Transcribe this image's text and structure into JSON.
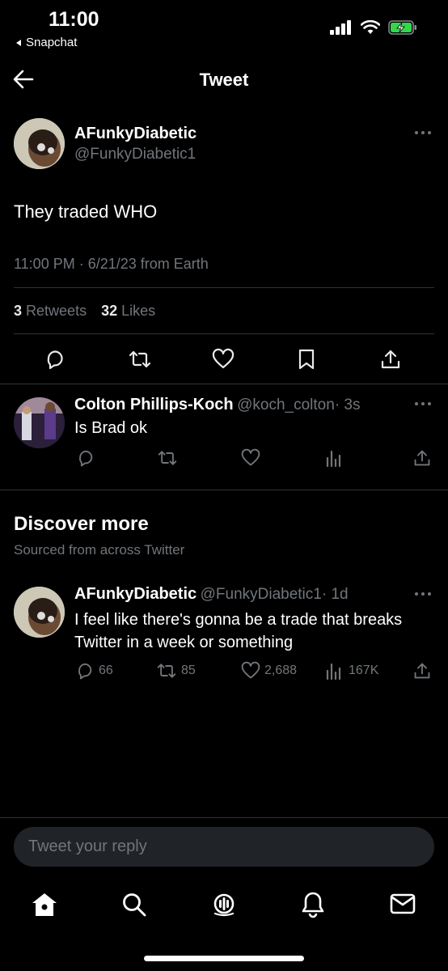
{
  "status_bar": {
    "time": "11:00",
    "back_app": "Snapchat"
  },
  "header": {
    "title": "Tweet"
  },
  "main_tweet": {
    "display_name": "AFunkyDiabetic",
    "handle": "@FunkyDiabetic1",
    "text": "They traded WHO",
    "timestamp": "11:00 PM · 6/21/23 from Earth",
    "retweets_count": "3",
    "retweets_label": "Retweets",
    "likes_count": "32",
    "likes_label": "Likes"
  },
  "reply": {
    "display_name": "Colton Phillips-Koch",
    "handle": "@koch_colton",
    "time": "· 3s",
    "text": "Is Brad ok"
  },
  "discover": {
    "title": "Discover more",
    "subtitle": "Sourced from across Twitter"
  },
  "discover_tweet": {
    "display_name": "AFunkyDiabetic",
    "handle": "@FunkyDiabetic1",
    "time": "· 1d",
    "text_line1": "I feel like there's gonna be a trade that breaks",
    "text_line2": "Twitter in a week or something",
    "replies": "66",
    "retweets": "85",
    "likes": "2,688",
    "views": "167K"
  },
  "reply_box": {
    "placeholder": "Tweet your reply"
  },
  "colors": {
    "background": "#000000",
    "text": "#e7e9ea",
    "muted": "#71767b",
    "divider": "#2f3336",
    "input": "#202327",
    "battery_charge": "#32d74b"
  }
}
